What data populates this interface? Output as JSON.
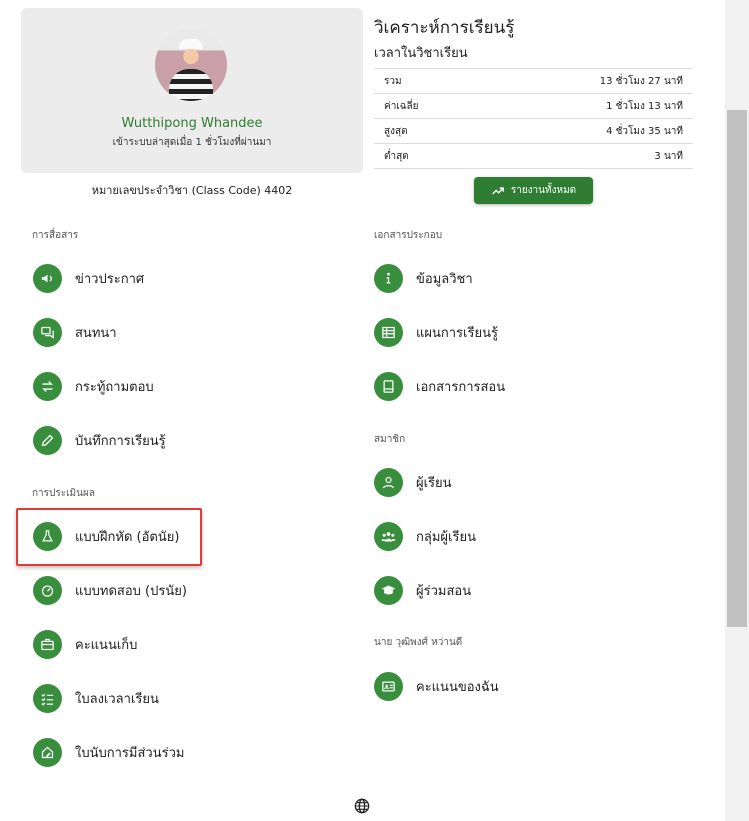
{
  "profile": {
    "name": "Wutthipong Whandee",
    "last_login": "เข้าระบบล่าสุดเมื่อ 1 ชั่วโมงที่ผ่านมา",
    "class_code": "หมายเลขประจำวิชา (Class Code) 4402"
  },
  "analytics": {
    "title": "วิเคราะห์การเรียนรู้",
    "subtitle": "เวลาในวิชาเรียน",
    "rows": [
      {
        "label": "รวม",
        "value": "13 ชั่วโมง 27 นาที"
      },
      {
        "label": "ค่าเฉลี่ย",
        "value": "1 ชั่วโมง 13 นาที"
      },
      {
        "label": "สูงสุด",
        "value": "4 ชั่วโมง 35 นาที"
      },
      {
        "label": "ต่ำสุด",
        "value": "3 นาที"
      }
    ],
    "report_button": "รายงานทั้งหมด"
  },
  "sections": {
    "communication": "การสื่อสาร",
    "assessment": "การประเมินผล",
    "documents": "เอกสารประกอบ",
    "members": "สมาชิก",
    "personal": "นาย วุฒิพงศ์ หว่านดี"
  },
  "menu": {
    "news": "ข่าวประกาศ",
    "chat": "สนทนา",
    "qa": "กระทู้ถามตอบ",
    "journal": "บันทึกการเรียนรู้",
    "practice": "แบบฝึกหัด (อัตนัย)",
    "test": "แบบทดสอบ (ปรนัย)",
    "scores": "คะแนนเก็บ",
    "attendance": "ใบลงเวลาเรียน",
    "participation": "ใบนับการมีส่วนร่วม",
    "course_info": "ข้อมูลวิชา",
    "lesson_plan": "แผนการเรียนรู้",
    "teaching_docs": "เอกสารการสอน",
    "learners": "ผู้เรียน",
    "learner_groups": "กลุ่มผู้เรียน",
    "co_teachers": "ผู้ร่วมสอน",
    "my_scores": "คะแนนของฉัน"
  },
  "colors": {
    "accent": "#388e3c",
    "name_green": "#2e7d32",
    "highlight": "#e53935"
  }
}
